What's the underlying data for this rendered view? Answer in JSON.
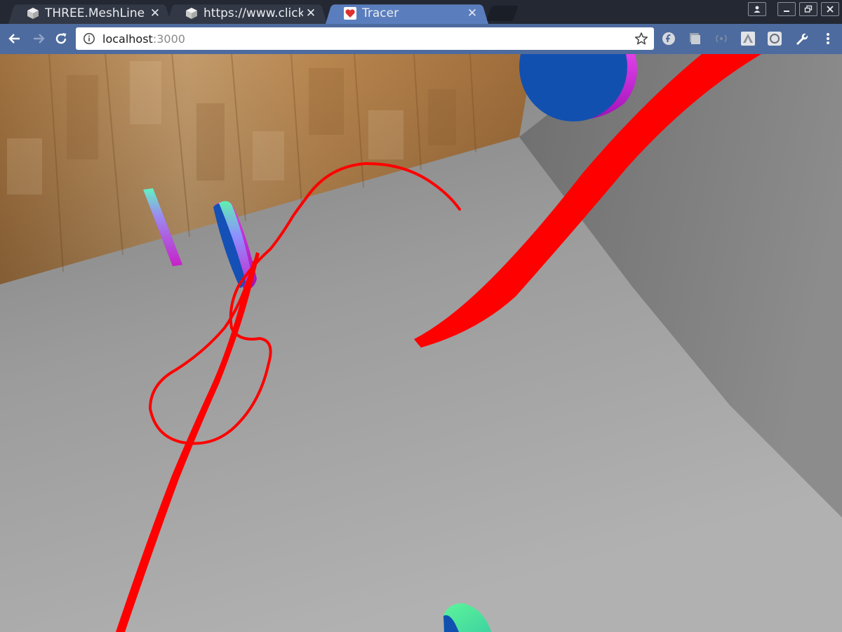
{
  "browser": {
    "tabs": [
      {
        "title": "THREE.MeshLine - D",
        "favicon": "cube-icon",
        "active": false
      },
      {
        "title": "https://www.clickto",
        "favicon": "cube-icon",
        "active": false
      },
      {
        "title": "Tracer",
        "favicon": "heart-icon",
        "active": true
      }
    ],
    "close_glyph": "✕",
    "url": {
      "host": "localhost",
      "port": ":3000"
    },
    "colors": {
      "active_tab": "#5a7ebd",
      "toolbar": "#4d6b9e",
      "tabstrip": "#232833"
    }
  },
  "scene": {
    "description_icons": [
      "back-arrow-icon",
      "forward-arrow-icon",
      "reload-icon",
      "info-icon",
      "star-icon"
    ],
    "colors": {
      "trace": "#ff0000",
      "disc_blue": "#1250b0",
      "disc_magenta": "#c21fcf",
      "disc_green": "#58f08c",
      "floor": "#a3a3a3",
      "wall_wood": "#b48a5e"
    }
  }
}
